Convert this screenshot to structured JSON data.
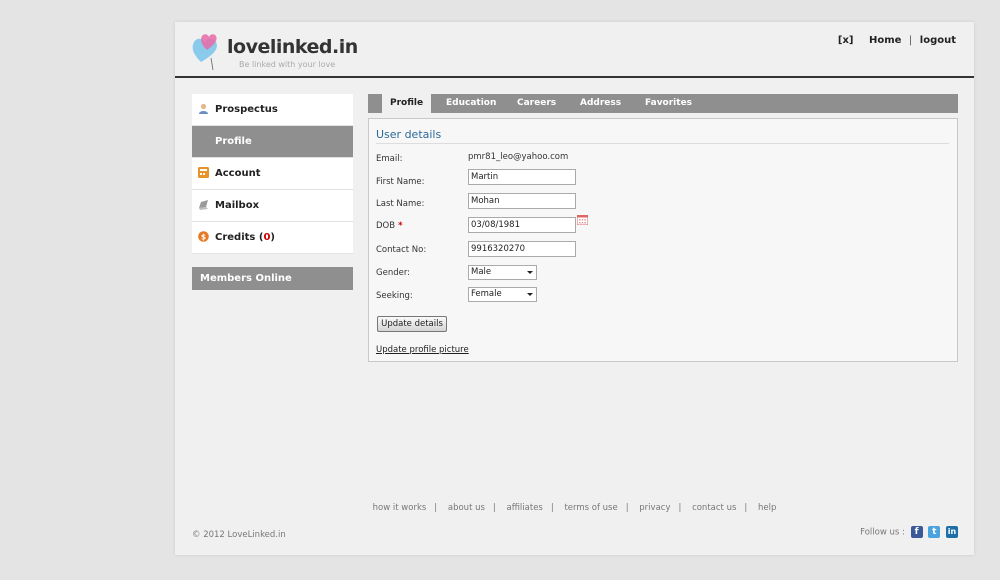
{
  "header": {
    "logo_text": "lovelinked.in",
    "tagline": "Be linked with your love",
    "links": [
      "[x]",
      "Home",
      "logout"
    ]
  },
  "sidebar": {
    "items": [
      {
        "label": "Prospectus",
        "icon": "user-icon"
      },
      {
        "label": "Profile",
        "icon": "",
        "active": true
      },
      {
        "label": "Account",
        "icon": "calculator-icon"
      },
      {
        "label": "Mailbox",
        "icon": "mailbox-icon"
      },
      {
        "label": "Credits",
        "icon": "coin-icon",
        "count": "0"
      }
    ],
    "members_online": "Members Online"
  },
  "tabs": [
    "Profile",
    "Education",
    "Careers",
    "Address",
    "Favorites"
  ],
  "form": {
    "title": "User details",
    "email_label": "Email:",
    "email_value": "pmr81_leo@yahoo.com",
    "first_name_label": "First Name:",
    "first_name_value": "Martin",
    "last_name_label": "Last Name:",
    "last_name_value": "Mohan",
    "dob_label": "DOB",
    "dob_required": "*",
    "dob_value": "03/08/1981",
    "contact_label": "Contact No:",
    "contact_value": "9916320270",
    "gender_label": "Gender:",
    "gender_value": "Male",
    "seeking_label": "Seeking:",
    "seeking_value": "Female",
    "update_button": "Update details",
    "update_picture_link": "Update profile picture"
  },
  "footer": {
    "links": [
      "how it works",
      "about us",
      "affiliates",
      "terms of use",
      "privacy",
      "contact us",
      "help"
    ],
    "copyright": "© 2012 LoveLinked.in",
    "follow_label": "Follow us :"
  },
  "colors": {
    "nav_gray": "#8f8f8f",
    "title_blue": "#2b6a9a",
    "required_red": "#cc0000",
    "facebook": "#3b5998",
    "twitter": "#4aa3df",
    "linkedin": "#1e6fa8"
  }
}
